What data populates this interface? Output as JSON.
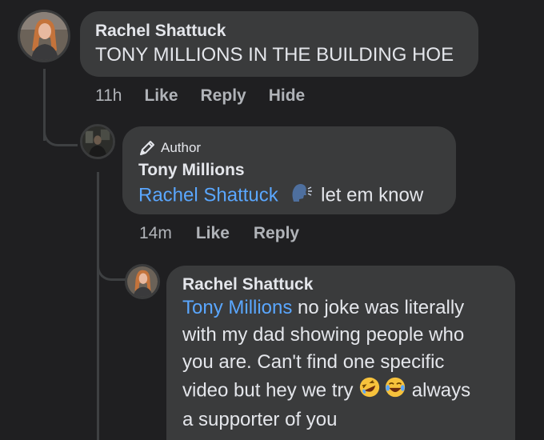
{
  "comments": [
    {
      "author": "Rachel Shattuck",
      "text": "TONY MILLIONS IN THE BUILDING HOE",
      "time": "11h",
      "actions": [
        "Like",
        "Reply",
        "Hide"
      ]
    },
    {
      "badge": "Author",
      "author": "Tony Millions",
      "mention": "Rachel Shattuck",
      "text": "let em know",
      "time": "14m",
      "actions": [
        "Like",
        "Reply"
      ]
    },
    {
      "author": "Rachel Shattuck",
      "mention": "Tony Millions",
      "text_line1": " no joke was literally",
      "text_line2": "with my dad showing people who",
      "text_line3": "you are. Can't find one specific",
      "text_line4a": "video but hey we try ",
      "text_line4b": " always",
      "text_line5": "a supporter of you"
    }
  ],
  "colors": {
    "background": "#1f1f21",
    "bubble": "#3a3b3c",
    "mention": "#5aa7ff",
    "meta": "#b0b3b8"
  }
}
